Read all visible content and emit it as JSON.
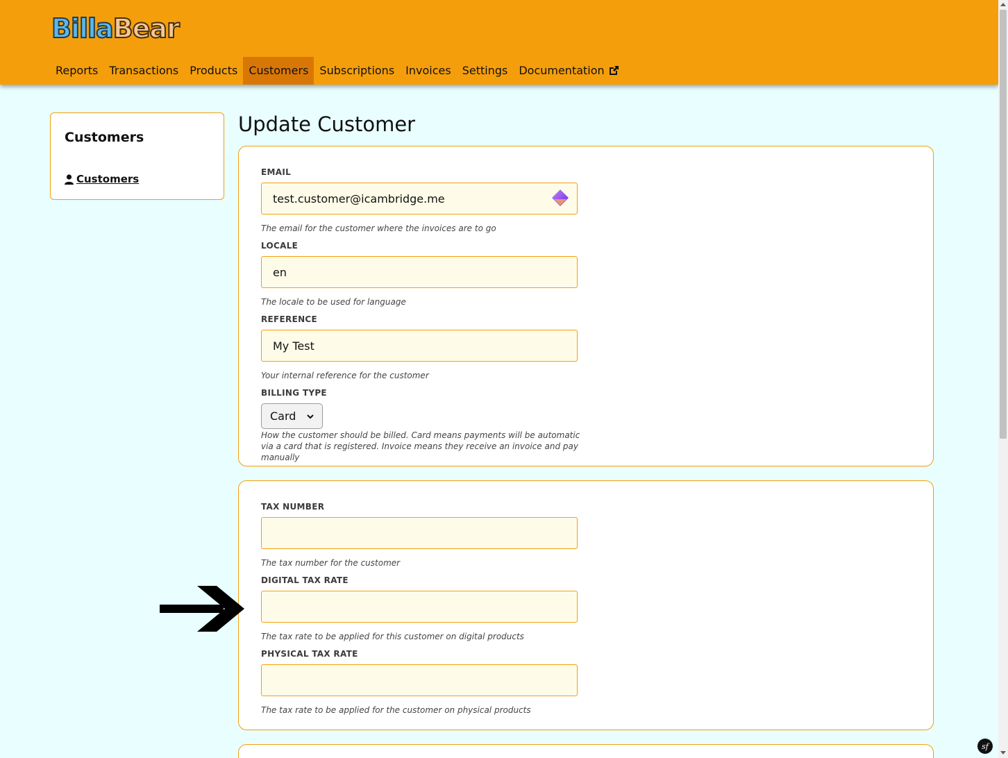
{
  "app": {
    "logo_part1": "Billa",
    "logo_part2": "Bear"
  },
  "nav": {
    "items": [
      {
        "label": "Reports"
      },
      {
        "label": "Transactions"
      },
      {
        "label": "Products"
      },
      {
        "label": "Customers",
        "active": true
      },
      {
        "label": "Subscriptions"
      },
      {
        "label": "Invoices"
      },
      {
        "label": "Settings"
      },
      {
        "label": "Documentation",
        "icon": "external-link-icon"
      }
    ]
  },
  "sidebar": {
    "title": "Customers",
    "link_label": "Customers",
    "link_icon": "user-icon"
  },
  "page": {
    "title": "Update Customer"
  },
  "form": {
    "email": {
      "label": "EMAIL",
      "value": "test.customer@icambridge.me",
      "help": "The email for the customer where the invoices are to go"
    },
    "locale": {
      "label": "LOCALE",
      "value": "en",
      "help": "The locale to be used for language"
    },
    "reference": {
      "label": "REFERENCE",
      "value": "My Test",
      "help": "Your internal reference for the customer"
    },
    "billing_type": {
      "label": "BILLING TYPE",
      "selected": "Card",
      "help": "How the customer should be billed. Card means payments will be automatic via a card that is registered. Invoice means they receive an invoice and pay manually"
    },
    "tax_number": {
      "label": "TAX NUMBER",
      "value": "",
      "help": "The tax number for the customer"
    },
    "digital_tax_rate": {
      "label": "DIGITAL TAX RATE",
      "value": "",
      "help": "The tax rate to be applied for this customer on digital products"
    },
    "physical_tax_rate": {
      "label": "PHYSICAL TAX RATE",
      "value": "",
      "help": "The tax rate to be applied for the customer on physical products"
    }
  },
  "colors": {
    "header": "#f59e0b",
    "nav_active": "#d97706",
    "background": "#e8feff",
    "input_bg": "#fefce8"
  }
}
